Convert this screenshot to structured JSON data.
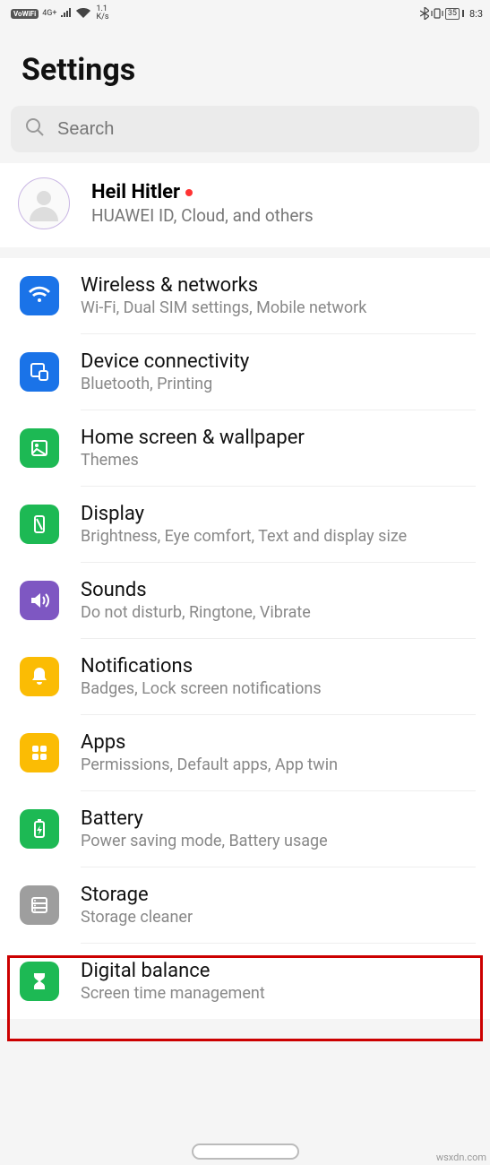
{
  "status_bar": {
    "vowifi": "VoWiFi",
    "net_label": "4G+",
    "speed_top": "1.1",
    "speed_bottom": "K/s",
    "battery_pct": "35",
    "time": "8:3"
  },
  "page": {
    "title": "Settings"
  },
  "search": {
    "placeholder": "Search"
  },
  "account": {
    "name": "Heil Hitler",
    "subtitle": "HUAWEI ID, Cloud, and others"
  },
  "items": [
    {
      "icon": "wifi-icon",
      "color": "blue",
      "title": "Wireless & networks",
      "subtitle": "Wi-Fi, Dual SIM settings, Mobile network"
    },
    {
      "icon": "device-connectivity-icon",
      "color": "blue2",
      "title": "Device connectivity",
      "subtitle": "Bluetooth, Printing"
    },
    {
      "icon": "wallpaper-icon",
      "color": "green",
      "title": "Home screen & wallpaper",
      "subtitle": "Themes"
    },
    {
      "icon": "display-icon",
      "color": "green",
      "title": "Display",
      "subtitle": "Brightness, Eye comfort, Text and display size"
    },
    {
      "icon": "sound-icon",
      "color": "purple",
      "title": "Sounds",
      "subtitle": "Do not disturb, Ringtone, Vibrate"
    },
    {
      "icon": "notification-icon",
      "color": "yellow",
      "title": "Notifications",
      "subtitle": "Badges, Lock screen notifications"
    },
    {
      "icon": "apps-icon",
      "color": "yellow",
      "title": "Apps",
      "subtitle": "Permissions, Default apps, App twin"
    },
    {
      "icon": "battery-icon",
      "color": "green",
      "title": "Battery",
      "subtitle": "Power saving mode, Battery usage"
    },
    {
      "icon": "storage-icon",
      "color": "gray",
      "title": "Storage",
      "subtitle": "Storage cleaner"
    },
    {
      "icon": "digital-balance-icon",
      "color": "green2",
      "title": "Digital balance",
      "subtitle": "Screen time management"
    }
  ],
  "watermark": "wsxdn.com"
}
